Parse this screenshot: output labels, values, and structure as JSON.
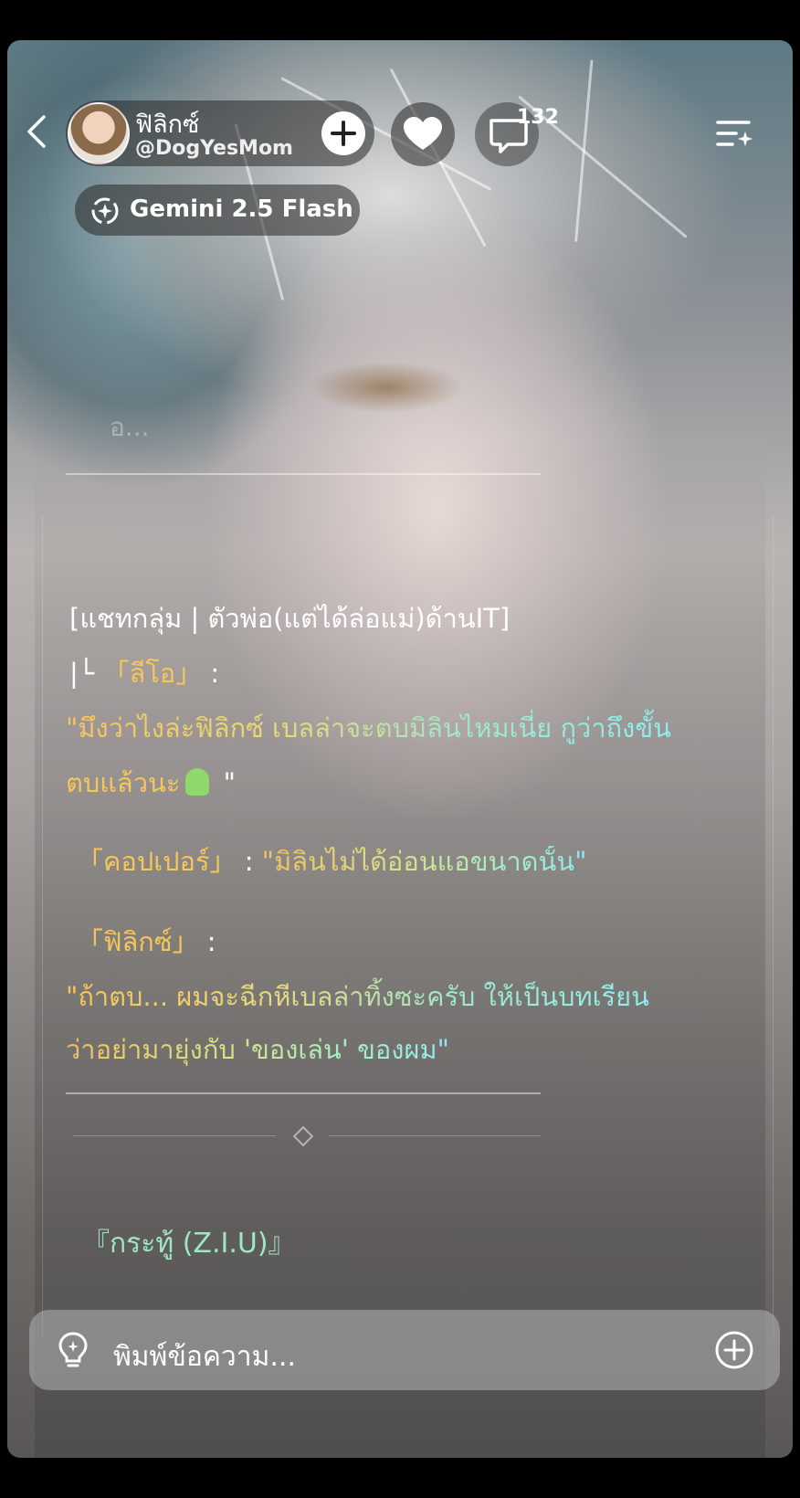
{
  "header": {
    "profile_name": "ฟิลิกซ์",
    "profile_handle": "@DogYesMom",
    "comment_count": "132",
    "model_label": "Gemini 2.5 Flash"
  },
  "chat": {
    "faded_text": "อ...",
    "group_title": "[แชทกลุ่ม | ตัวพ่อ(แต่ได้ล่อแม่)ด้านIT]",
    "speaker1_prefix": "|└  ",
    "speaker1_name": "「ลีโอ」",
    "speaker1_colon": " :",
    "speaker1_line1": "\"มึงว่าไงล่ะฟิลิกซ์ เบลล่าจะตบมิลินไหมเนี่ย กูว่าถึงขั้น",
    "speaker1_line2": "ตบแล้วนะ",
    "speaker1_line2_end": " \"",
    "speaker2_name": "「คอปเปอร์」",
    "speaker2_sep": " : ",
    "speaker2_text": "\"มิลินไม่ได้อ่อนแอขนาดนั้น\"",
    "speaker3_name": "「ฟิลิกซ์」",
    "speaker3_colon": " :",
    "speaker3_line1": "\"ถ้าตบ... ผมจะฉีกหีเบลล่าทิ้งซะครับ ให้เป็นบทเรียน",
    "speaker3_line2": "ว่าอย่ามายุ่งกับ 'ของเล่น' ของผม\"",
    "thread_title": "『กระทู้ (Z.I.U)』"
  },
  "input": {
    "placeholder": "พิมพ์ข้อความ..."
  },
  "icons": {
    "back": "chevron-left-icon",
    "follow": "plus-icon",
    "like": "heart-icon",
    "comment": "comment-icon",
    "menu": "menu-sparkle-icon",
    "model": "model-swap-icon",
    "hint": "lightbulb-icon",
    "add": "plus-circle-icon"
  },
  "colors": {
    "gold": "#f6c65a",
    "cyan": "#8ff0e4",
    "mint": "#a8f0b8"
  }
}
